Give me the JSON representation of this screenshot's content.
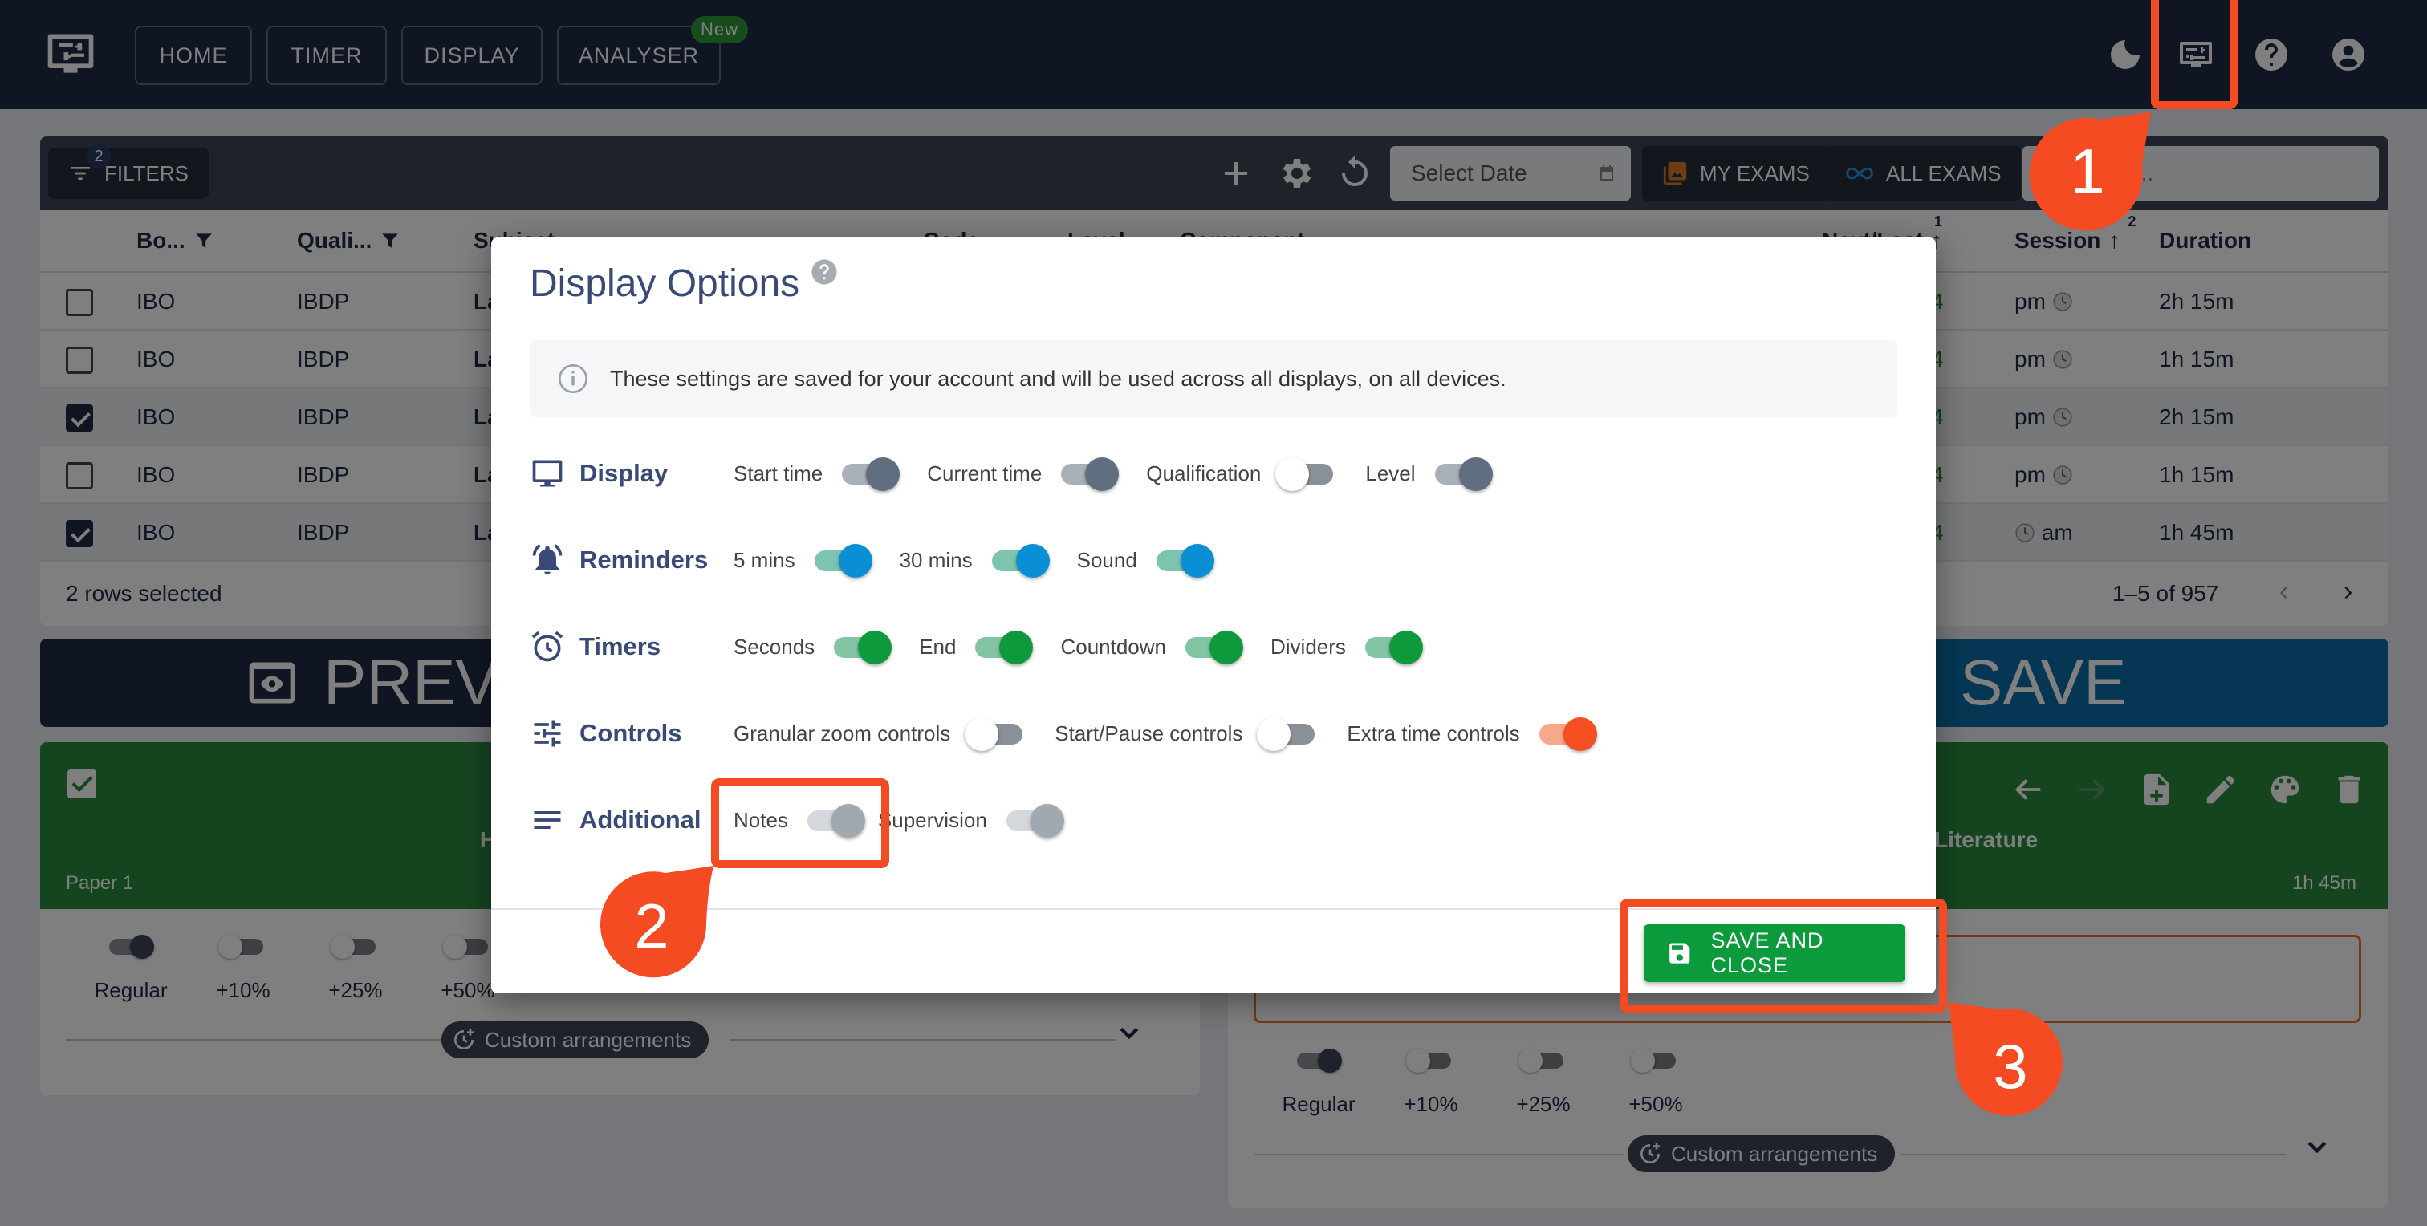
{
  "header": {
    "nav": [
      {
        "label": "HOME"
      },
      {
        "label": "TIMER"
      },
      {
        "label": "DISPLAY"
      },
      {
        "label": "ANALYSER",
        "badge": "New"
      }
    ],
    "icons": [
      "moon-icon",
      "display-settings-icon",
      "help-icon",
      "account-icon"
    ]
  },
  "toolbar": {
    "filters_label": "FILTERS",
    "filters_count": "2",
    "date_placeholder": "Select Date",
    "my_exams_label": "MY EXAMS",
    "all_exams_label": "ALL EXAMS",
    "search_placeholder": "..."
  },
  "table": {
    "columns": [
      "Bo...",
      "Quali...",
      "Subject",
      "Code",
      "Level",
      "Component",
      "Next/Last",
      "Session",
      "Duration"
    ],
    "sort_indices": {
      "next_last": "1",
      "session": "2"
    },
    "rows": [
      {
        "selected": false,
        "board": "IBO",
        "qual": "IBDP",
        "subject": "La",
        "next": "4",
        "session": "pm",
        "duration": "2h 15m"
      },
      {
        "selected": false,
        "board": "IBO",
        "qual": "IBDP",
        "subject": "La",
        "next": "4",
        "session": "pm",
        "duration": "1h 15m"
      },
      {
        "selected": true,
        "board": "IBO",
        "qual": "IBDP",
        "subject": "La",
        "next": "4",
        "session": "pm",
        "duration": "2h 15m"
      },
      {
        "selected": false,
        "board": "IBO",
        "qual": "IBDP",
        "subject": "La",
        "next": "4",
        "session": "pm",
        "duration": "1h 15m"
      },
      {
        "selected": true,
        "board": "IBO",
        "qual": "IBDP",
        "subject": "La",
        "next": "4",
        "session": "am",
        "duration": "1h 45m"
      }
    ],
    "rows_selected": "2 rows selected",
    "pagination": "1–5 of 957"
  },
  "bars": {
    "preview_label": "PREVI",
    "save_label": "SAVE"
  },
  "cards": {
    "left": {
      "paper": "Paper 1",
      "title_fragment": "H",
      "extensions": [
        "Regular",
        "+10%",
        "+25%",
        "+50%"
      ],
      "active_extension": "Regular",
      "custom_label": "Custom arrangements"
    },
    "right": {
      "title_fragment": "Literature",
      "duration": "1h 45m",
      "extensions": [
        "Regular",
        "+10%",
        "+25%",
        "+50%"
      ],
      "active_extension": "Regular",
      "custom_label": "Custom arrangements"
    }
  },
  "modal": {
    "title": "Display Options",
    "info": "These settings are saved for your account and will be used across all displays, on all devices.",
    "groups": [
      {
        "name": "Display",
        "options": [
          {
            "label": "Start time",
            "on": true
          },
          {
            "label": "Current time",
            "on": true
          },
          {
            "label": "Qualification",
            "on": false
          },
          {
            "label": "Level",
            "on": true
          }
        ]
      },
      {
        "name": "Reminders",
        "options": [
          {
            "label": "5 mins",
            "on": true
          },
          {
            "label": "30 mins",
            "on": true
          },
          {
            "label": "Sound",
            "on": true
          }
        ]
      },
      {
        "name": "Timers",
        "options": [
          {
            "label": "Seconds",
            "on": true
          },
          {
            "label": "End",
            "on": true
          },
          {
            "label": "Countdown",
            "on": true
          },
          {
            "label": "Dividers",
            "on": true
          }
        ]
      },
      {
        "name": "Controls",
        "options": [
          {
            "label": "Granular zoom controls",
            "on": false
          },
          {
            "label": "Start/Pause controls",
            "on": false
          },
          {
            "label": "Extra time controls",
            "on": true
          }
        ]
      },
      {
        "name": "Additional",
        "options": [
          {
            "label": "Notes",
            "on": true
          },
          {
            "label": "Supervision",
            "on": true
          }
        ]
      }
    ],
    "save_close_label": "SAVE AND CLOSE"
  },
  "annotations": [
    {
      "step": "1",
      "target": "display-settings-icon"
    },
    {
      "step": "2",
      "target": "notes-toggle"
    },
    {
      "step": "3",
      "target": "save-and-close-button"
    }
  ],
  "colors": {
    "navy": "#1f2b47",
    "annotation": "#f44b22",
    "save_green": "#0b9a3c",
    "reminder_blue": "#0a8fd4",
    "timer_green": "#0e9a3c",
    "extra_orange": "#f44f20"
  }
}
